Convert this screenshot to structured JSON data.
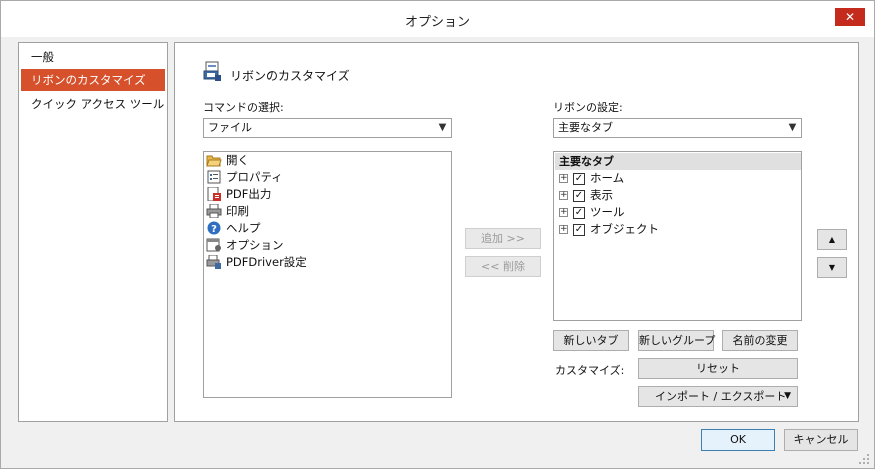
{
  "window": {
    "title": "オプション",
    "close_glyph": "✕"
  },
  "nav": {
    "items": [
      {
        "label": "一般",
        "selected": false
      },
      {
        "label": "リボンのカスタマイズ",
        "selected": true
      },
      {
        "label": "クイック アクセス ツール",
        "selected": false
      }
    ]
  },
  "main": {
    "heading": "リボンのカスタマイズ",
    "commands": {
      "label": "コマンドの選択:",
      "combo_value": "ファイル",
      "items": [
        {
          "label": "開く",
          "icon": "open-folder-icon"
        },
        {
          "label": "プロパティ",
          "icon": "properties-icon"
        },
        {
          "label": "PDF出力",
          "icon": "pdf-output-icon"
        },
        {
          "label": "印刷",
          "icon": "printer-icon"
        },
        {
          "label": "ヘルプ",
          "icon": "help-icon"
        },
        {
          "label": "オプション",
          "icon": "options-icon"
        },
        {
          "label": "PDFDriver設定",
          "icon": "pdfdriver-settings-icon"
        }
      ]
    },
    "add_label": "追加 >>",
    "remove_label": "<< 削除",
    "ribbon": {
      "label": "リボンの設定:",
      "combo_value": "主要なタブ",
      "tree_header": "主要なタブ",
      "tabs": [
        {
          "label": "ホーム",
          "checked": true
        },
        {
          "label": "表示",
          "checked": true
        },
        {
          "label": "ツール",
          "checked": true
        },
        {
          "label": "オブジェクト",
          "checked": true
        }
      ]
    },
    "new_tab_label": "新しいタブ",
    "new_group_label": "新しいグループ",
    "rename_label": "名前の変更",
    "customize_label": "カスタマイズ:",
    "reset_label": "リセット",
    "import_export_label": "インポート / エクスポート",
    "move_up_glyph": "▲",
    "move_down_glyph": "▼"
  },
  "footer": {
    "ok_label": "OK",
    "cancel_label": "キャンセル"
  },
  "colors": {
    "accent": "#d6502b",
    "close": "#c42b1c"
  }
}
